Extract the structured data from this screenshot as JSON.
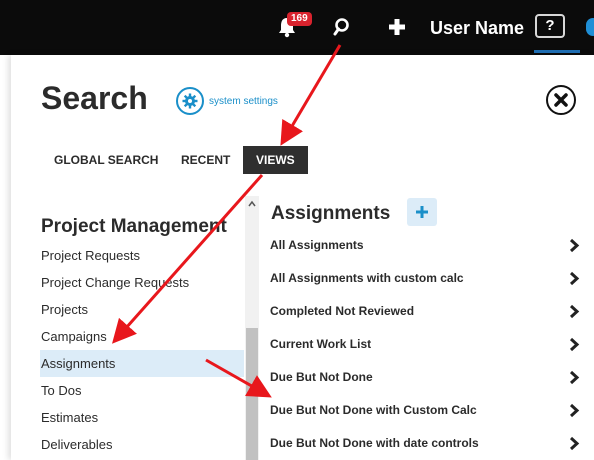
{
  "topbar": {
    "notification_count": "169",
    "username": "User Name",
    "help_label": "?"
  },
  "search_panel": {
    "title": "Search",
    "settings_link": "system settings",
    "tabs": [
      {
        "label": "GLOBAL SEARCH",
        "active": false
      },
      {
        "label": "RECENT",
        "active": false
      },
      {
        "label": "VIEWS",
        "active": true
      }
    ],
    "section_title": "Project Management",
    "section_items": [
      "Project Requests",
      "Project Change Requests",
      "Projects",
      "Campaigns",
      "Assignments",
      "To Dos",
      "Estimates",
      "Deliverables"
    ],
    "selected_item": "Assignments",
    "views_title": "Assignments",
    "views": [
      "All Assignments",
      "All Assignments with custom calc",
      "Completed Not Reviewed",
      "Current Work List",
      "Due But Not Done",
      "Due But Not Done with Custom Calc",
      "Due But Not Done with date controls"
    ]
  },
  "colors": {
    "accent": "#1a8fc9",
    "selected_row": "#dcecf8",
    "annotation_arrow": "#e8171c",
    "active_tab": "#2f2f2f",
    "badge": "#d9232e"
  }
}
